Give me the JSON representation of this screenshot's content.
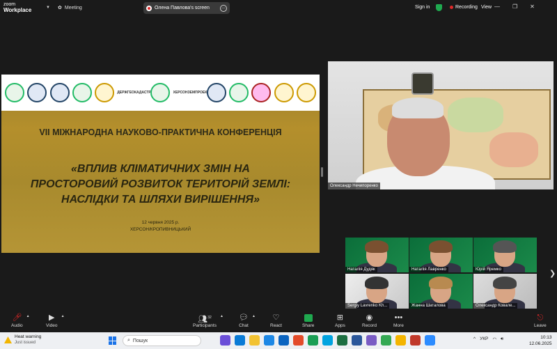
{
  "app": {
    "brand_top": "zoom",
    "brand_bottom": "Workplace"
  },
  "topbar": {
    "meeting_label": "Meeting",
    "screen_share_label": "Олена Павлова's screen",
    "signin_label": "Sign in",
    "recording_label": "Recording",
    "view_label": "View"
  },
  "slide": {
    "conference": "VII МІЖНАРОДНА НАУКОВО-ПРАКТИЧНА КОНФЕРЕНЦІЯ",
    "title_line1": "«ВПЛИВ КЛІМАТИЧНИХ ЗМІН НА",
    "title_line2": "ПРОСТОРОВИЙ РОЗВИТОК ТЕРИТОРІЙ ЗЕМЛІ:",
    "title_line3": "НАСЛІДКИ ТА ШЛЯХИ ВИРІШЕННЯ»",
    "date": "12 червня 2025 р.",
    "place": "ХЕРСОН/КРОПИВНИЦЬКИЙ",
    "logo_text_1": "ДЕРЖГЕОКАДАСТР",
    "logo_text_2": "ХЕРСОНЗЕМПРОЕКТ"
  },
  "speaker": {
    "name": "Олександр Нечипоренко"
  },
  "gallery": {
    "participants": [
      {
        "name": "Наталія Дудяк"
      },
      {
        "name": "Наталія Лавренко"
      },
      {
        "name": "Юрій Яремко"
      },
      {
        "name": "Sergiy Lavrenko Kh..."
      },
      {
        "name": "Жанна Шаталова"
      },
      {
        "name": "Олександр Ковале..."
      }
    ]
  },
  "toolbar": {
    "audio": "Audio",
    "video": "Video",
    "participants": "Participants",
    "participants_count": "32",
    "chat": "Chat",
    "react": "React",
    "share": "Share",
    "apps": "Apps",
    "record": "Record",
    "more": "More",
    "leave": "Leave"
  },
  "taskbar": {
    "weather_title": "Heat warning",
    "weather_sub": "Just issued",
    "search_placeholder": "Пошук",
    "lang": "УКР",
    "time": "10:13",
    "date": "12.06.2025"
  },
  "colors": {
    "accent_green": "#1fa94f",
    "recording_red": "#e02828",
    "slide_gold": "#b48f2c"
  }
}
